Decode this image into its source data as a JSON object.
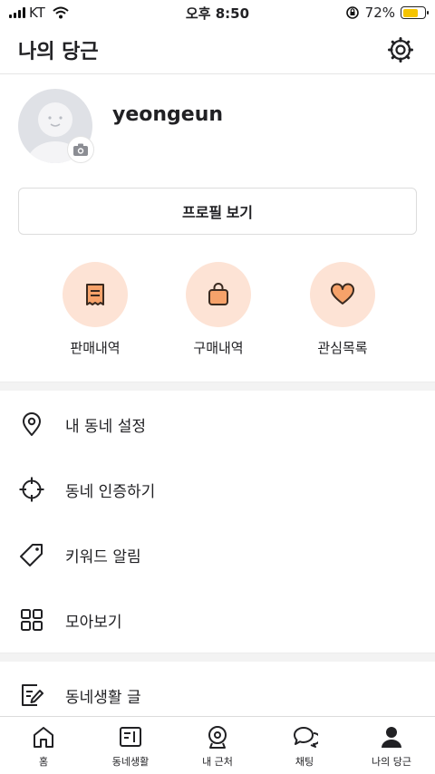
{
  "status_bar": {
    "carrier": "KT",
    "time": "오후 8:50",
    "battery_percent": "72%",
    "battery_level": 0.72,
    "icons": [
      "signal-icon",
      "wifi-icon",
      "orientation-lock-icon",
      "battery-icon"
    ]
  },
  "header": {
    "title": "나의 당근",
    "settings_icon": "gear-icon"
  },
  "profile": {
    "nickname": "yeongeun",
    "avatar_icon": "default-avatar",
    "camera_icon": "camera-icon",
    "view_profile_label": "프로필 보기"
  },
  "quick_actions": [
    {
      "label": "판매내역",
      "icon": "receipt-icon"
    },
    {
      "label": "구매내역",
      "icon": "shopping-bag-icon"
    },
    {
      "label": "관심목록",
      "icon": "heart-icon"
    }
  ],
  "menu": [
    {
      "label": "내 동네 설정",
      "icon": "location-pin-icon"
    },
    {
      "label": "동네 인증하기",
      "icon": "crosshair-icon"
    },
    {
      "label": "키워드 알림",
      "icon": "tag-icon"
    },
    {
      "label": "모아보기",
      "icon": "grid-icon"
    },
    {
      "label": "동네생활 글",
      "icon": "edit-note-icon"
    }
  ],
  "bottom_nav": [
    {
      "label": "홈",
      "icon": "home-icon"
    },
    {
      "label": "동네생활",
      "icon": "board-icon"
    },
    {
      "label": "내 근처",
      "icon": "map-pin-icon"
    },
    {
      "label": "채팅",
      "icon": "chat-icon"
    },
    {
      "label": "나의 당근",
      "icon": "person-icon",
      "active": true
    }
  ],
  "colors": {
    "accent_soft": "#fde3d5",
    "accent": "#f6a26a",
    "accent_stroke": "#3a2a20",
    "battery": "#f5c400"
  }
}
